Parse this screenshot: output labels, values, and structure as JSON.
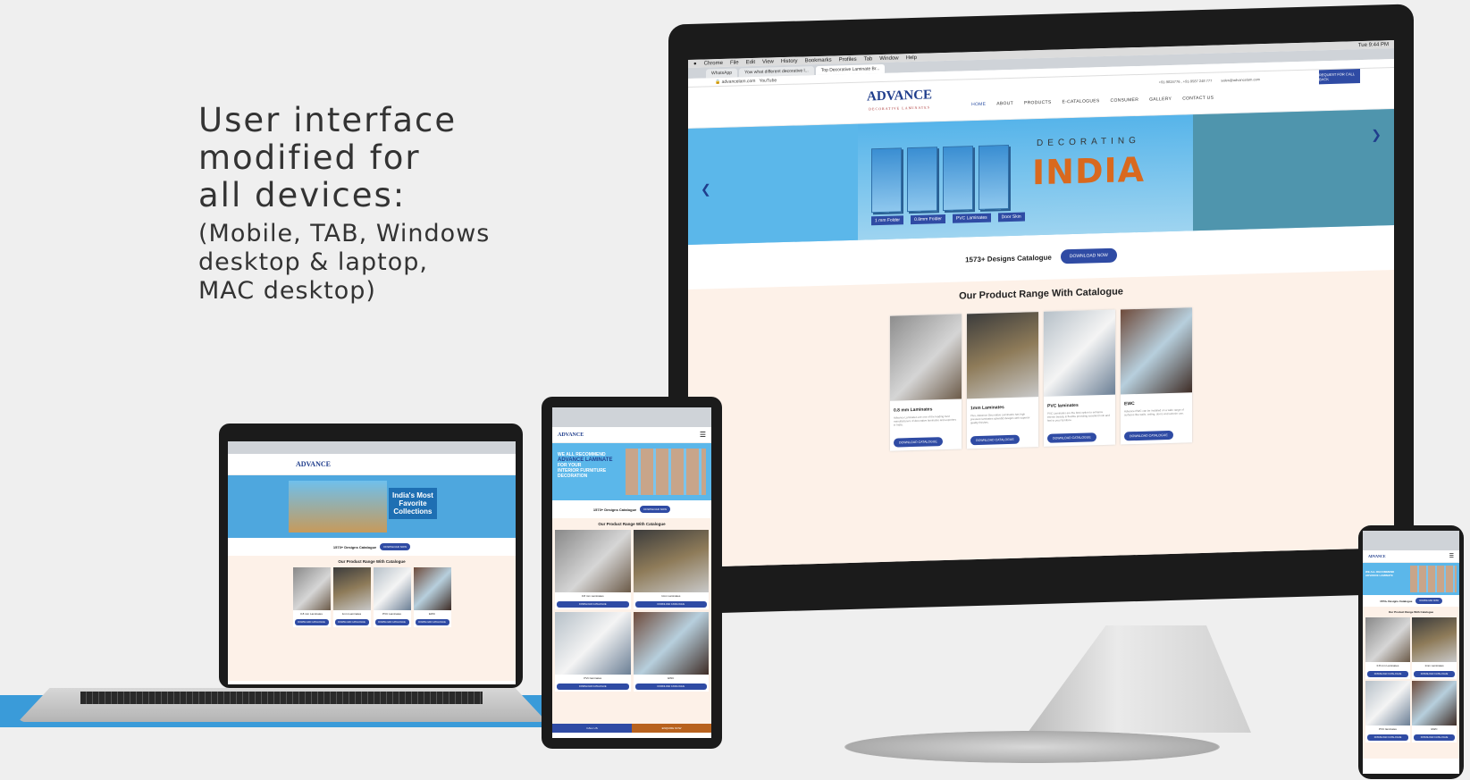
{
  "headline": "User interface\nmodified  for\nall devices:",
  "subline": "(Mobile, TAB, Windows\ndesktop & laptop,\nMAC desktop)",
  "browser": {
    "menus": [
      "Chrome",
      "File",
      "Edit",
      "View",
      "History",
      "Bookmarks",
      "Profiles",
      "Tab",
      "Window",
      "Help"
    ],
    "clock": "Tue 9:44 PM",
    "tabs": [
      "WhatsApp",
      "Yow what different decorative l...",
      "Top Decorative Laminate Br..."
    ],
    "url": "advancelam.com",
    "bookmark": "YouTube"
  },
  "site": {
    "logo": "ADVANCE",
    "logo_tag": "DECORATIVE LAMINATES",
    "phone": "+91-9824776 , +91-9587 248 777",
    "email": "sales@advancelam.com",
    "enquiry": "REQUEST FOR CALL BACK",
    "nav": [
      "HOME",
      "ABOUT",
      "PRODUCTS",
      "E-CATALOGUES",
      "CONSUMER",
      "GALLERY",
      "CONTACT US"
    ],
    "hero_decor": "DECORATING",
    "hero_india": "INDIA",
    "book_labels": [
      "1 mm Folder",
      "0.8mm Folder",
      "PVC Laminates",
      "Door Skin"
    ],
    "catalogue_text": "1573+ Designs Catalogue",
    "download_now": "DOWNLOAD NOW",
    "range_title": "Our Product Range With Catalogue",
    "products": [
      {
        "name": "0.8 mm Laminates",
        "desc": "Advance Laminates are one of the leading best manufacturers of decorative laminates and exporters in India.",
        "btn": "DOWNLOAD CATALOGUE"
      },
      {
        "name": "1mm Laminates",
        "desc": "Plus, Advance Decorative Laminates has high pressure laminates splendid designs with superior quality finishes.",
        "btn": "DOWNLOAD CATALOGUE"
      },
      {
        "name": "PVC laminates",
        "desc": "PVC Laminates are the best option to enhance interior beauty & flexible providing excellent look and feel to your furniture.",
        "btn": "DOWNLOAD CATALOGUE"
      },
      {
        "name": "EWC",
        "desc": "Advance EWC can be installed on a wide range of surfaces like walls, ceiling, doors and exterior use.",
        "btn": "DOWNLOAD CATALOGUE"
      }
    ]
  },
  "laptop": {
    "hero_text_1": "India's Most",
    "hero_text_2": "Favorite",
    "hero_text_3": "Collections",
    "catalogue": "1573+ Designs Catalogue",
    "range_title": "Our Product Range With Catalogue",
    "products": [
      "0.8 mm Laminates",
      "1mm Laminates",
      "PVC Laminates",
      "EWC"
    ]
  },
  "tablet": {
    "hero_line_1": "WE ALL RECOMMEND",
    "hero_line_2": "ADVANCE LAMINATE",
    "hero_line_3": "FOR YOUR",
    "hero_line_4": "INTERIOR FURNITURE",
    "hero_line_5": "DECORATION",
    "catalogue": "1573+ Designs Catalogue",
    "btn": "DOWNLOAD NOW",
    "range_title": "Our Product Range With Catalogue",
    "products": [
      "0.8 mm Laminates",
      "1mm Laminates",
      "PVC laminates",
      "EWC"
    ],
    "dl": "DOWNLOAD CATALOGUE",
    "call": "CALL US",
    "enquire": "ENQUIRE NOW"
  },
  "phone": {
    "hero_line_1": "WE ALL RECOMMEND",
    "hero_line_2": "ADVANCE LAMINATE",
    "catalogue": "1573+ Designs Catalogue",
    "btn": "DOWNLOAD NOW",
    "range_title": "Our Product Range With Catalogue",
    "products": [
      "0.8 mm Laminates",
      "1mm Laminates",
      "PVC laminates",
      "EWC"
    ]
  },
  "colors": {
    "brand_blue": "#2f4ba4",
    "hero_blue": "#5bb7ea",
    "cream": "#fdf1e8",
    "accent_bar": "#3a9bd9"
  }
}
